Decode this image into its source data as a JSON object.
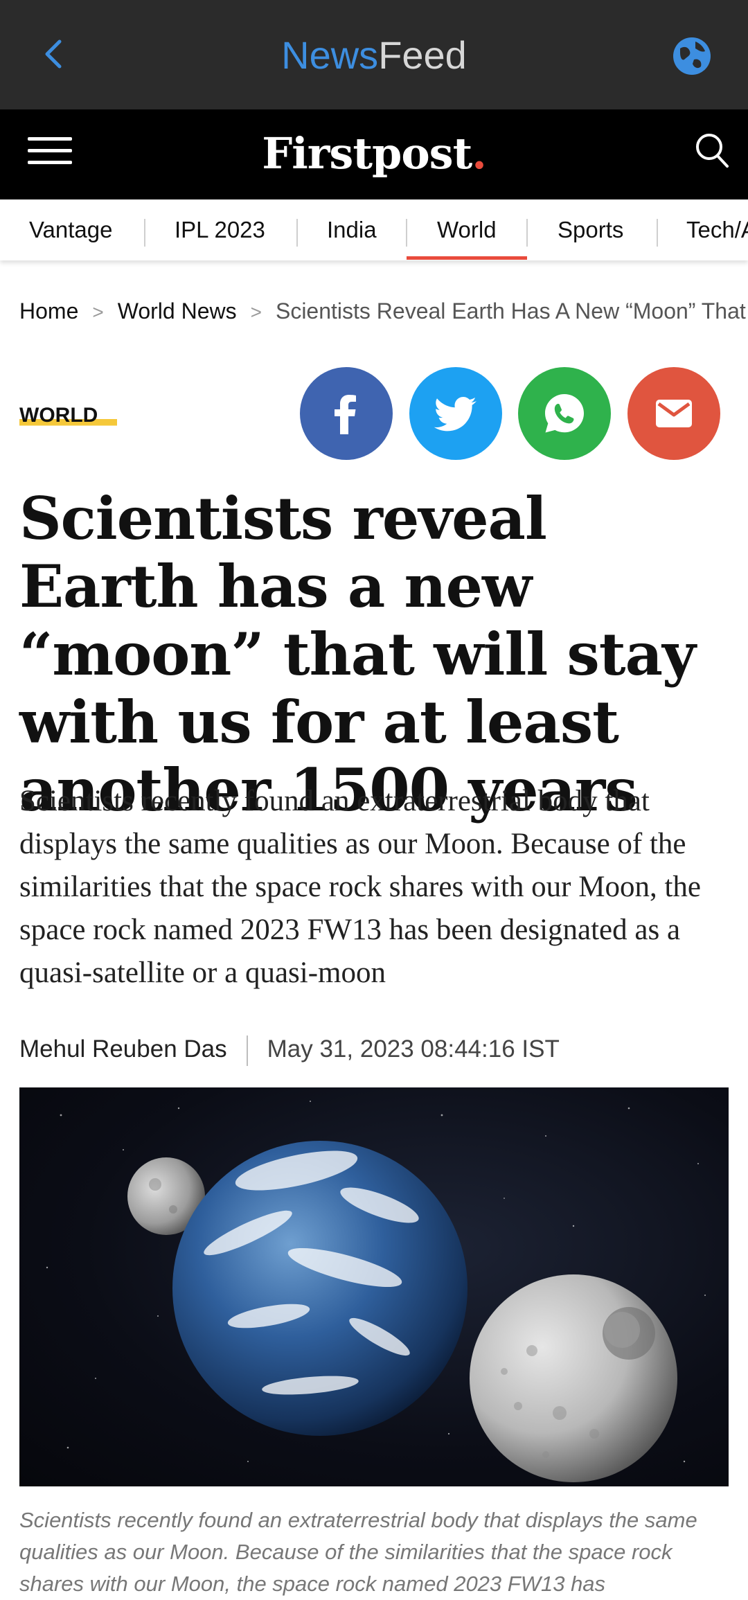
{
  "appbar": {
    "title_brand": "News",
    "title_rest": "Feed"
  },
  "site": {
    "logo_text": "Firstpost",
    "logo_dot": "."
  },
  "nav": {
    "items": [
      "Vantage",
      "IPL 2023",
      "India",
      "World",
      "Sports",
      "Tech/A"
    ],
    "active": "World"
  },
  "breadcrumb": {
    "home": "Home",
    "section": "World News",
    "current": "Scientists Reveal Earth Has A New “Moon” That Will"
  },
  "article": {
    "tag": "WORLD",
    "headline": "Scientists reveal Earth has a new “moon” that will stay with us for at least another 1500 years",
    "summary": "Scientists recently found an extraterrestrial body that displays the same qualities as our Moon. Because of the similarities that the space rock shares with our Moon, the space rock named 2023 FW13 has been designated as a quasi-satellite or a quasi-moon",
    "author": "Mehul Reuben Das",
    "date": "May 31, 2023 08:44:16 IST",
    "caption": "Scientists recently found an extraterrestrial body that displays the same qualities as our Moon. Because of the similarities that the space rock shares with our Moon, the space rock named 2023 FW13 has"
  },
  "colors": {
    "brand_blue": "#3d8ee0",
    "accent_red": "#e94b3c",
    "tag_highlight": "#f5c83a",
    "facebook": "#3f64b0",
    "twitter": "#1da1f2",
    "whatsapp": "#2fb24c",
    "email": "#e0553f"
  }
}
